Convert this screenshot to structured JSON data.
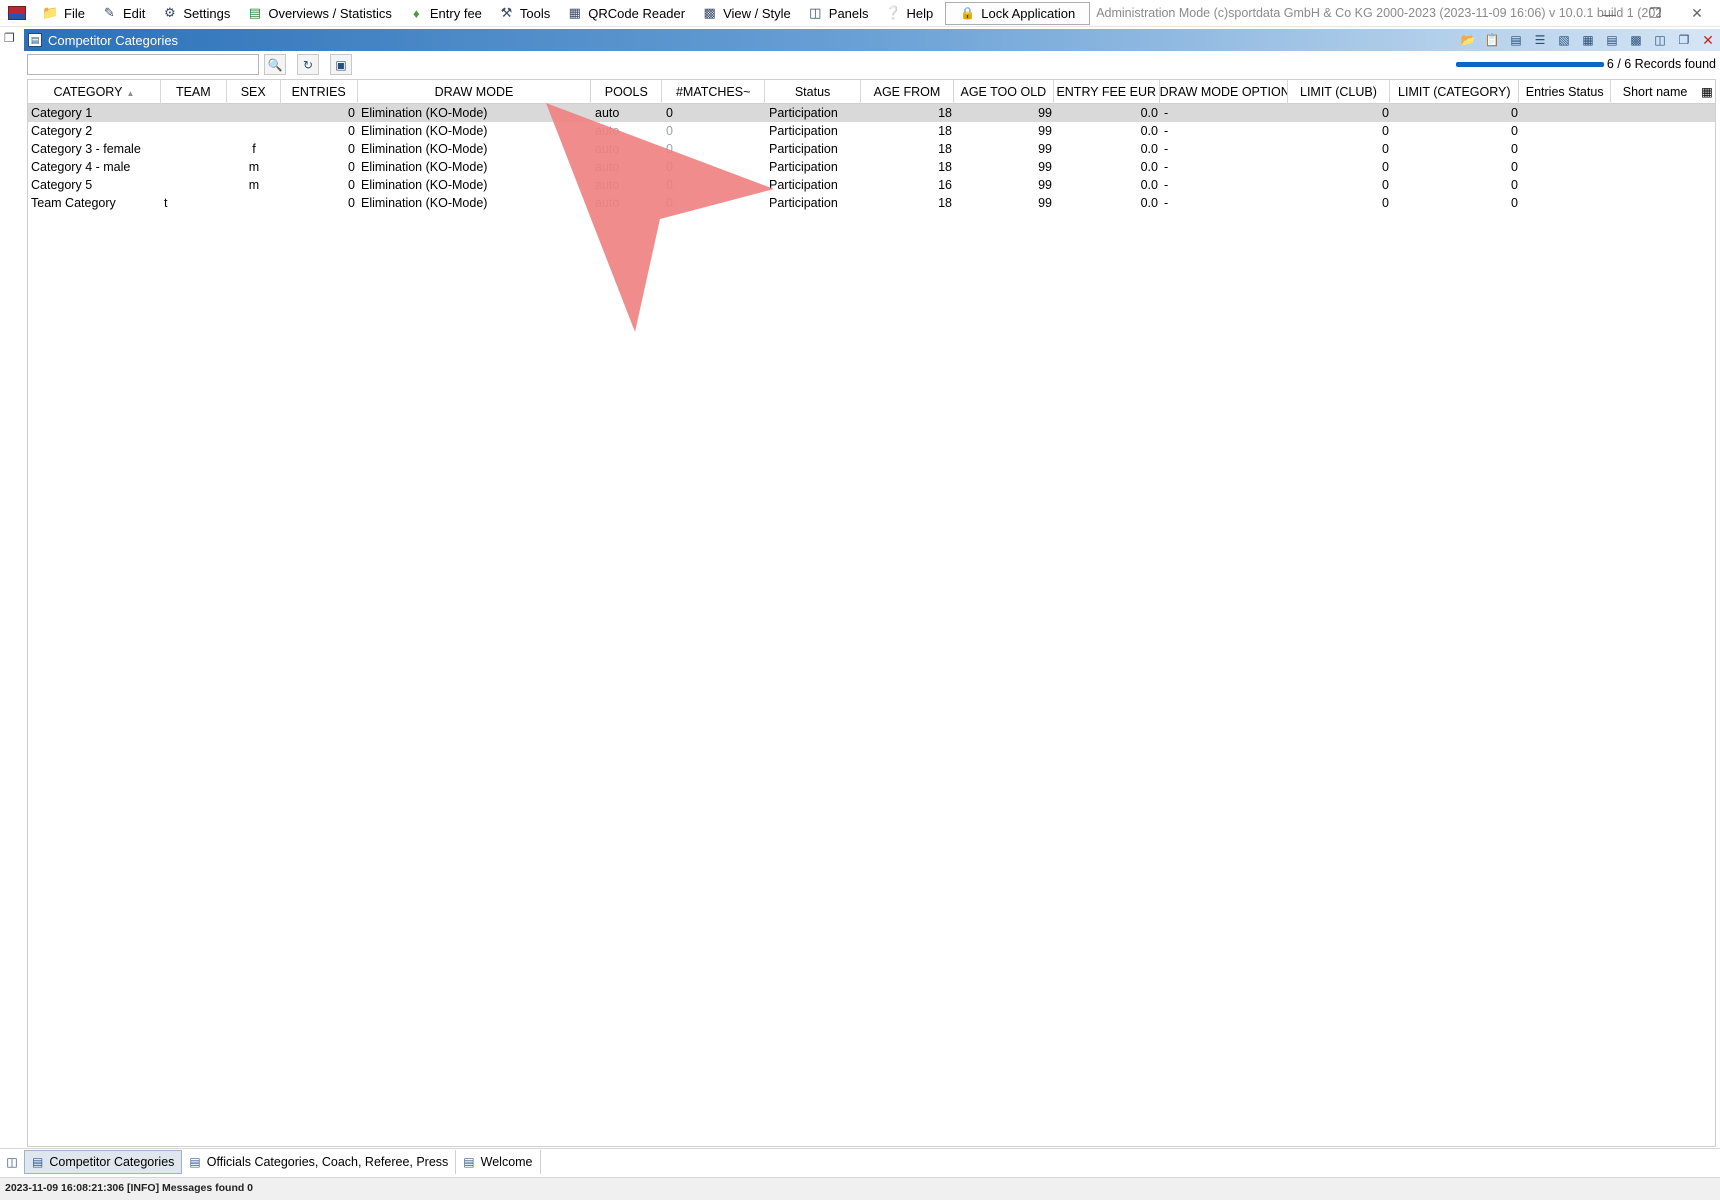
{
  "menubar": {
    "items": [
      {
        "label": "File",
        "icon": "folder-icon"
      },
      {
        "label": "Edit",
        "icon": "edit-icon"
      },
      {
        "label": "Settings",
        "icon": "gear-icon"
      },
      {
        "label": "Overviews / Statistics",
        "icon": "statistics-icon"
      },
      {
        "label": "Entry fee",
        "icon": "money-icon"
      },
      {
        "label": "Tools",
        "icon": "wrench-icon"
      },
      {
        "label": "QRCode Reader",
        "icon": "qrcode-icon"
      },
      {
        "label": "View / Style",
        "icon": "view-icon"
      },
      {
        "label": "Panels",
        "icon": "panels-icon"
      },
      {
        "label": "Help",
        "icon": "help-icon"
      }
    ],
    "lock_label": "Lock Application",
    "admin_text": "Administration Mode (c)sportdata GmbH & Co KG 2000-2023 (2023-11-09 16:06)  v 10.0.1 build 1 (2023-07..."
  },
  "panel": {
    "title": "Competitor Categories"
  },
  "search": {
    "value": "",
    "placeholder": ""
  },
  "records_found": "6 / 6 Records found",
  "table": {
    "columns": [
      "CATEGORY",
      "TEAM",
      "SEX",
      "ENTRIES",
      "DRAW MODE",
      "POOLS",
      "#MATCHES~",
      "Status",
      "AGE FROM",
      "AGE TOO OLD",
      "ENTRY FEE EUR",
      "DRAW MODE OPTION",
      "LIMIT (CLUB)",
      "LIMIT (CATEGORY)",
      "Entries Status",
      "Short name"
    ],
    "rows": [
      {
        "category": "Category 1",
        "team": "",
        "sex": "",
        "entries": "0",
        "draw_mode": "Elimination (KO-Mode)",
        "pools": "auto",
        "matches": "0",
        "status": "Participation",
        "age_from": "18",
        "age_too_old": "99",
        "entry_fee": "0.0",
        "draw_mode_option": "-",
        "limit_club": "0",
        "limit_category": "0",
        "entries_status": "",
        "short_name": ""
      },
      {
        "category": "Category 2",
        "team": "",
        "sex": "",
        "entries": "0",
        "draw_mode": "Elimination (KO-Mode)",
        "pools": "auto",
        "matches": "0",
        "status": "Participation",
        "age_from": "18",
        "age_too_old": "99",
        "entry_fee": "0.0",
        "draw_mode_option": "-",
        "limit_club": "0",
        "limit_category": "0",
        "entries_status": "",
        "short_name": ""
      },
      {
        "category": "Category 3 - female",
        "team": "",
        "sex": "f",
        "entries": "0",
        "draw_mode": "Elimination (KO-Mode)",
        "pools": "auto",
        "matches": "0",
        "status": "Participation",
        "age_from": "18",
        "age_too_old": "99",
        "entry_fee": "0.0",
        "draw_mode_option": "-",
        "limit_club": "0",
        "limit_category": "0",
        "entries_status": "",
        "short_name": ""
      },
      {
        "category": "Category 4 - male",
        "team": "",
        "sex": "m",
        "entries": "0",
        "draw_mode": "Elimination (KO-Mode)",
        "pools": "auto",
        "matches": "0",
        "status": "Participation",
        "age_from": "18",
        "age_too_old": "99",
        "entry_fee": "0.0",
        "draw_mode_option": "-",
        "limit_club": "0",
        "limit_category": "0",
        "entries_status": "",
        "short_name": ""
      },
      {
        "category": "Category 5",
        "team": "",
        "sex": "m",
        "entries": "0",
        "draw_mode": "Elimination (KO-Mode)",
        "pools": "auto",
        "matches": "0",
        "status": "Participation",
        "age_from": "16",
        "age_too_old": "99",
        "entry_fee": "0.0",
        "draw_mode_option": "-",
        "limit_club": "0",
        "limit_category": "0",
        "entries_status": "",
        "short_name": ""
      },
      {
        "category": "Team Category",
        "team": "t",
        "sex": "",
        "entries": "0",
        "draw_mode": "Elimination (KO-Mode)",
        "pools": "auto",
        "matches": "0",
        "status": "Participation",
        "age_from": "18",
        "age_too_old": "99",
        "entry_fee": "0.0",
        "draw_mode_option": "-",
        "limit_club": "0",
        "limit_category": "0",
        "entries_status": "",
        "short_name": ""
      }
    ]
  },
  "tabs": [
    {
      "label": "Competitor Categories",
      "active": true
    },
    {
      "label": "Officials Categories, Coach, Referee, Press",
      "active": false
    },
    {
      "label": "Welcome",
      "active": false
    }
  ],
  "statusbar": {
    "message": "2023-11-09 16:08:21:306 [INFO] Messages found 0"
  },
  "colors": {
    "title_bar_start": "#2b70b8",
    "selected_row": "#d9d9d9",
    "pointer_overlay": "#f08080"
  }
}
